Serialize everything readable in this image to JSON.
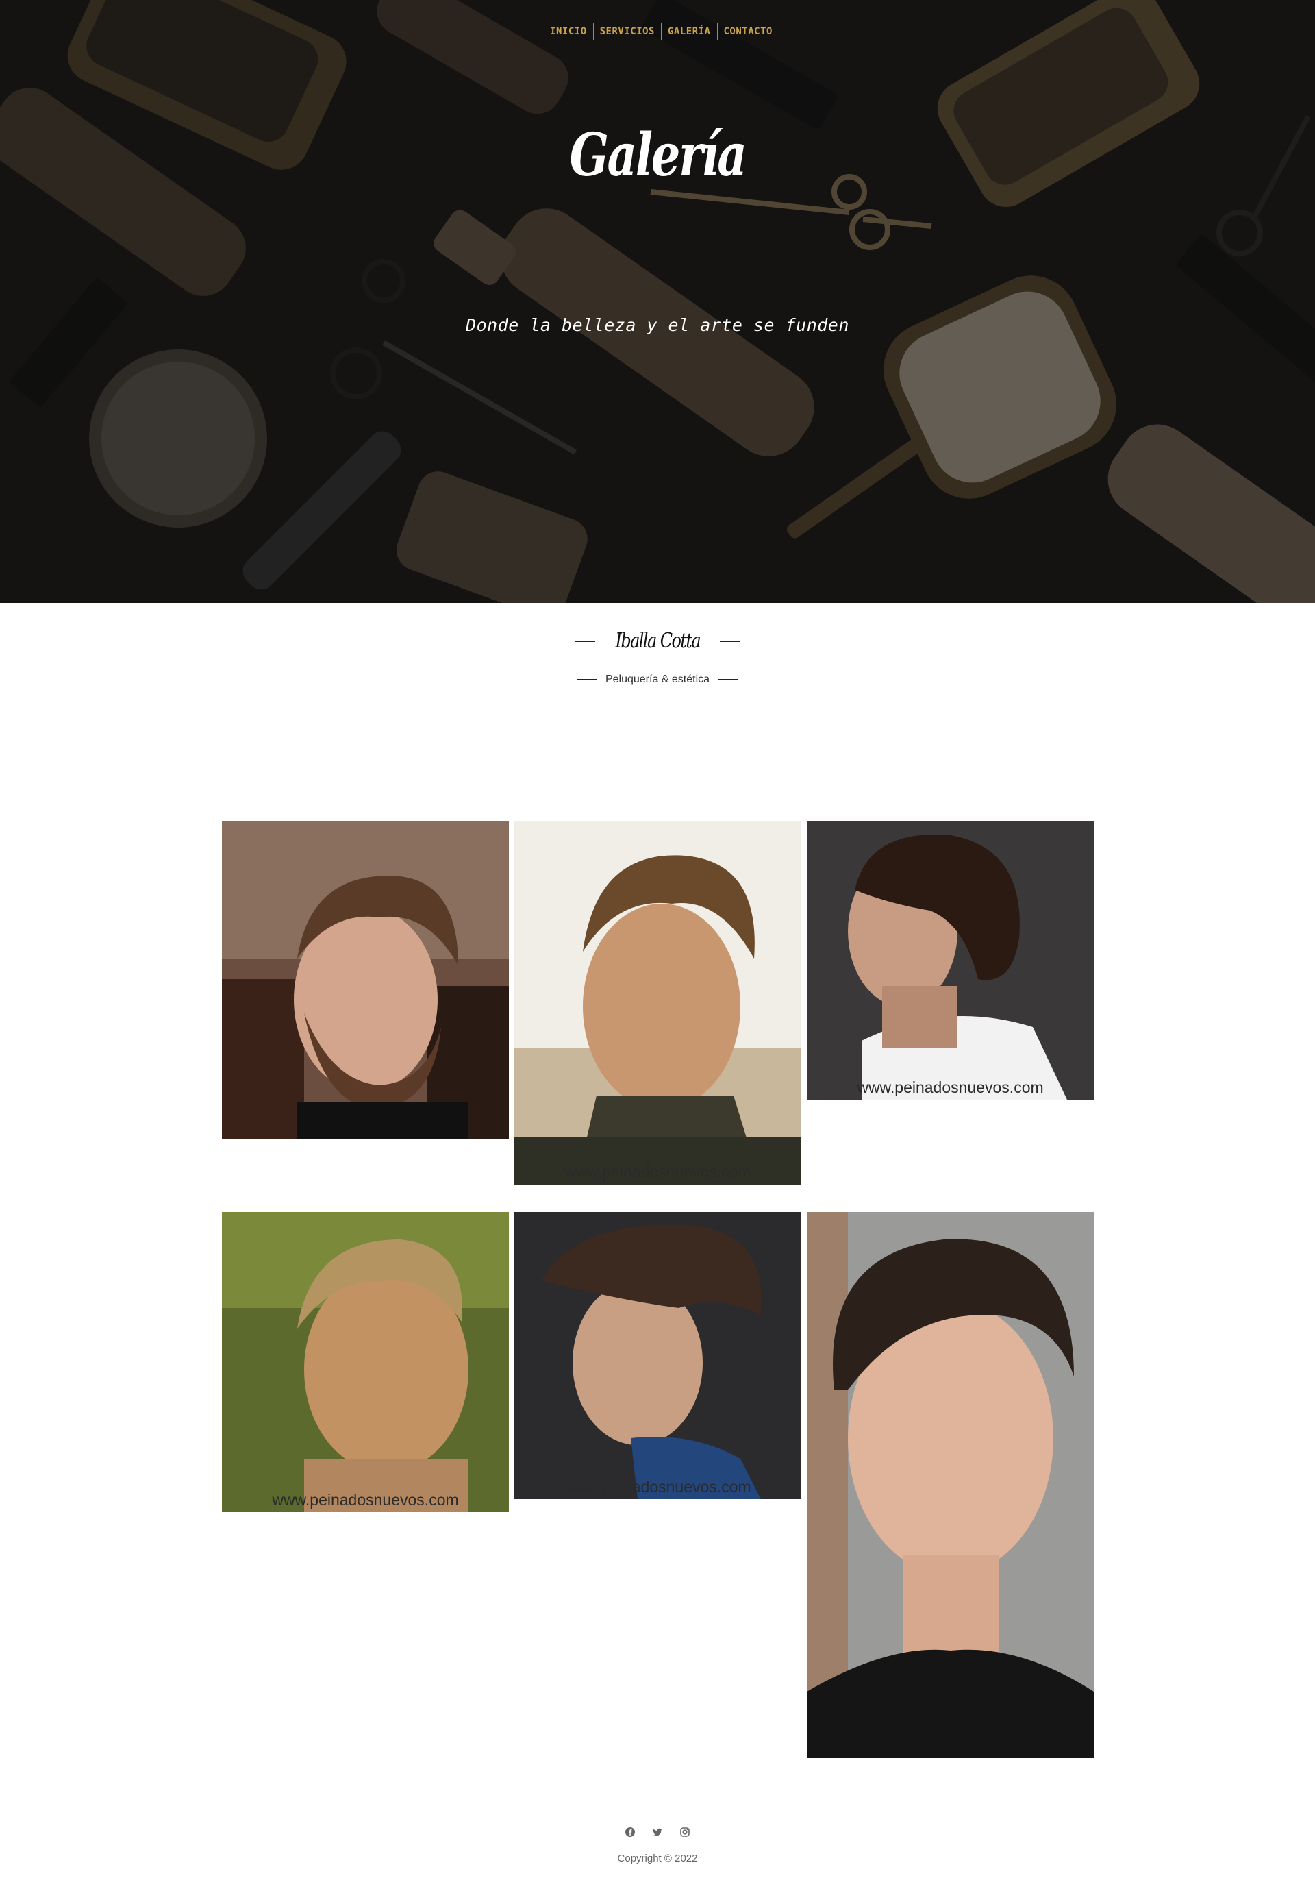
{
  "nav": {
    "items": [
      {
        "label": "INICIO"
      },
      {
        "label": "SERVICIOS"
      },
      {
        "label": "GALERÍA"
      },
      {
        "label": "CONTACTO"
      }
    ]
  },
  "hero": {
    "title": "Galería",
    "subtitle": "Donde la belleza y el arte se funden"
  },
  "brand": {
    "name": "Iballa Cotta",
    "tagline": "Peluquería & estética"
  },
  "gallery": {
    "photos": [
      {
        "id": 1,
        "alt": "hombre-corte-fade-barba",
        "watermark": ""
      },
      {
        "id": 2,
        "alt": "hombre-corte-militar",
        "watermark": "www.peinadosnuevos.com"
      },
      {
        "id": 3,
        "alt": "hombre-pelo-largo-rizado",
        "watermark": "www.peinadosnuevos.com"
      },
      {
        "id": 4,
        "alt": "hombre-corte-crop-rubio",
        "watermark": "www.peinadosnuevos.com"
      },
      {
        "id": 5,
        "alt": "hombre-corte-fade-alto",
        "watermark": "www.peinadosnuevos.com"
      },
      {
        "id": 6,
        "alt": "joven-pelo-ondulado",
        "watermark": ""
      }
    ]
  },
  "footer": {
    "social": [
      "facebook-icon",
      "twitter-icon",
      "instagram-icon"
    ],
    "copyright": "Copyright © 2022"
  },
  "colors": {
    "nav_link": "#c9a34a",
    "hero_bg": "#1a1918",
    "text_dark": "#111111"
  }
}
